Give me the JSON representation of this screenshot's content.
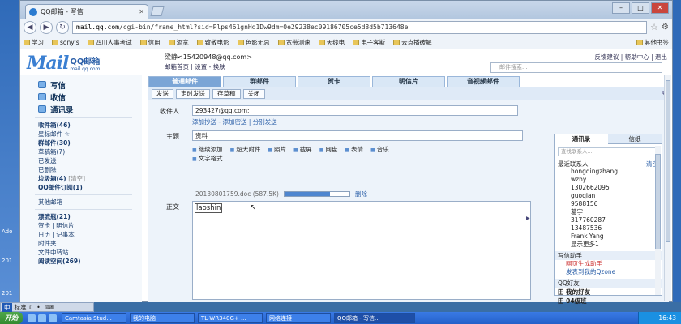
{
  "desktop": {
    "left_labels": [
      "Ado",
      "201",
      "201"
    ]
  },
  "browser": {
    "tab_title": "QQ邮箱 - 写信",
    "url_host": "mail.qq.com",
    "url_path": "/cgi-bin/frame_html?sid=Plps461gnHd1Dw9dm=0e29238ec09186705ce5d8d5b713648e",
    "bookmarks": [
      "学习",
      "sony's",
      "四川人事考试",
      "信用",
      "添宽",
      "致敬电影",
      "色影无忌",
      "宽带测速",
      "天线电",
      "电子客斯",
      "云点播破解",
      "其他书签"
    ]
  },
  "mail": {
    "logo_text": "Mail",
    "logo_cn": "QQ邮箱",
    "logo_domain": "mail.qq.com",
    "user": "梁静<15420948@qq.com>",
    "user_links": "邮箱首页 | 设置 - 换肤",
    "top_links": "反馈建议 | 帮助中心 | 退出",
    "search_placeholder": "邮件搜索..."
  },
  "folders": {
    "big": [
      "写信",
      "收信",
      "通讯录"
    ],
    "items": [
      {
        "label": "收件箱(46)",
        "bold": true
      },
      {
        "label": "星标邮件 ☆",
        "bold": false
      },
      {
        "label": "群邮件(30)",
        "bold": true
      },
      {
        "label": "草稿箱(7)",
        "bold": false
      },
      {
        "label": "已发送",
        "bold": false
      },
      {
        "label": "已删除",
        "bold": false
      },
      {
        "label": "垃圾箱(4)",
        "bold": true,
        "extra": "[清空]"
      },
      {
        "label": "QQ邮件订阅(1)",
        "bold": true
      },
      {
        "label": "其他邮箱",
        "bold": false
      },
      {
        "label": "漂流瓶(21)",
        "bold": true
      },
      {
        "label": "贺卡 | 明信片",
        "bold": false
      },
      {
        "label": "日历 | 记事本",
        "bold": false
      },
      {
        "label": "附件夹",
        "bold": false
      },
      {
        "label": "文件中转站",
        "bold": false
      },
      {
        "label": "阅读空间(269)",
        "bold": true
      }
    ]
  },
  "compose": {
    "tabs": [
      "普通邮件",
      "群邮件",
      "贺卡",
      "明信片",
      "音视频邮件"
    ],
    "actions": [
      "发送",
      "定时发送",
      "存草稿",
      "关闭"
    ],
    "to_label": "收件人",
    "to_value": "293427@qq.com;",
    "to_links": "添加抄送 - 添加密送 | 分别发送",
    "subject_label": "主题",
    "subject_value": "资料",
    "tools": [
      "继续添加",
      "超大附件",
      "照片",
      "截屏",
      "网盘",
      "表情",
      "音乐"
    ],
    "format_text": "文字格式",
    "attachment": "20130801759.doc (587.5K)",
    "attachment_progress": 0.7,
    "attachment_delete": "删除",
    "body_label": "正文",
    "body_text": "laoshin"
  },
  "contacts": {
    "tabs": [
      "通讯录",
      "信纸"
    ],
    "search_placeholder": "查找联系人...",
    "recent_label": "最近联系人",
    "clear_label": "清空",
    "items": [
      "hongdingzhang",
      "wzhy",
      "1302662095",
      "guoqian",
      "9588156",
      "葛宇",
      "317760287",
      "13487536",
      "Frank Yang",
      "显示更多1"
    ],
    "helper_title": "写信助手",
    "helper_items": [
      "网页生成助手",
      "发表到我的Qzone"
    ],
    "friends_title": "QQ好友",
    "groups": [
      "田 我的好友",
      "田 04级班"
    ]
  },
  "taskbar": {
    "lang_label": "标准",
    "start": "开始",
    "tasks": [
      "Camtasia Stud...",
      "我的电脑",
      "TL-WR340G+ ...",
      "网络连接",
      "QQ邮箱 - 写信..."
    ],
    "clock": "16:43"
  }
}
